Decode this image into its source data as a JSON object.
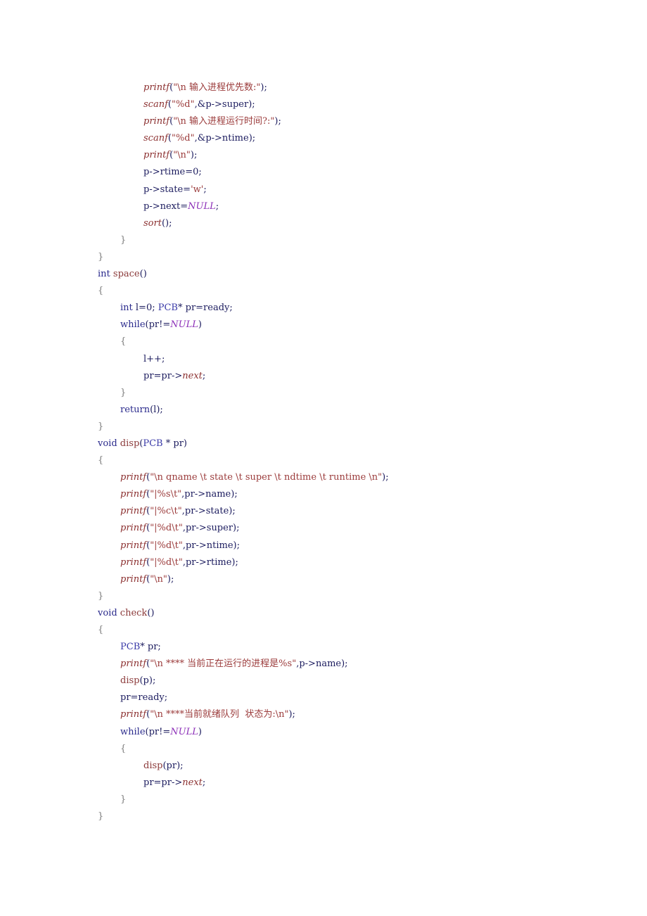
{
  "document": {
    "lines": [
      {
        "indent": 2,
        "tokens": [
          {
            "t": "printf",
            "c": "fni"
          },
          {
            "t": "(",
            "c": "id"
          },
          {
            "t": "\"\\n 输入进程优先数:\"",
            "c": "str"
          },
          {
            "t": ");",
            "c": "id"
          }
        ]
      },
      {
        "indent": 2,
        "tokens": [
          {
            "t": "scanf",
            "c": "fni"
          },
          {
            "t": "(",
            "c": "id"
          },
          {
            "t": "\"%d\"",
            "c": "str"
          },
          {
            "t": ",&p->super);",
            "c": "id"
          }
        ]
      },
      {
        "indent": 2,
        "tokens": [
          {
            "t": "printf",
            "c": "fni"
          },
          {
            "t": "(",
            "c": "id"
          },
          {
            "t": "\"\\n 输入进程运行时间?:\"",
            "c": "str"
          },
          {
            "t": ");",
            "c": "id"
          }
        ]
      },
      {
        "indent": 2,
        "tokens": [
          {
            "t": "scanf",
            "c": "fni"
          },
          {
            "t": "(",
            "c": "id"
          },
          {
            "t": "\"%d\"",
            "c": "str"
          },
          {
            "t": ",&p->ntime);",
            "c": "id"
          }
        ]
      },
      {
        "indent": 2,
        "tokens": [
          {
            "t": "printf",
            "c": "fni"
          },
          {
            "t": "(",
            "c": "id"
          },
          {
            "t": "\"\\n\"",
            "c": "str"
          },
          {
            "t": ");",
            "c": "id"
          }
        ]
      },
      {
        "indent": 2,
        "tokens": [
          {
            "t": "p->rtime=0;",
            "c": "id"
          }
        ]
      },
      {
        "indent": 2,
        "tokens": [
          {
            "t": "p->state=",
            "c": "id"
          },
          {
            "t": "'w'",
            "c": "str"
          },
          {
            "t": ";",
            "c": "id"
          }
        ]
      },
      {
        "indent": 2,
        "tokens": [
          {
            "t": "p->next=",
            "c": "id"
          },
          {
            "t": "NULL",
            "c": "nul"
          },
          {
            "t": ";",
            "c": "id"
          }
        ]
      },
      {
        "indent": 2,
        "tokens": [
          {
            "t": "sort",
            "c": "fni"
          },
          {
            "t": "();",
            "c": "id"
          }
        ]
      },
      {
        "indent": 1,
        "tokens": [
          {
            "t": "}",
            "c": "brace"
          }
        ]
      },
      {
        "indent": 0,
        "tokens": [
          {
            "t": "}",
            "c": "brace"
          }
        ]
      },
      {
        "indent": 0,
        "tokens": [
          {
            "t": "int",
            "c": "kw"
          },
          {
            "t": " ",
            "c": "id"
          },
          {
            "t": "space",
            "c": "fn"
          },
          {
            "t": "()",
            "c": "id"
          }
        ]
      },
      {
        "indent": 0,
        "tokens": [
          {
            "t": "{",
            "c": "brace"
          }
        ]
      },
      {
        "indent": 1,
        "tokens": [
          {
            "t": "int",
            "c": "kw"
          },
          {
            "t": " l=0; ",
            "c": "id"
          },
          {
            "t": "PCB",
            "c": "typ"
          },
          {
            "t": "* pr=ready;",
            "c": "id"
          }
        ]
      },
      {
        "indent": 1,
        "tokens": [
          {
            "t": "while",
            "c": "kw"
          },
          {
            "t": "(pr!=",
            "c": "id"
          },
          {
            "t": "NULL",
            "c": "nul"
          },
          {
            "t": ")",
            "c": "id"
          }
        ]
      },
      {
        "indent": 1,
        "tokens": [
          {
            "t": "{",
            "c": "brace"
          }
        ]
      },
      {
        "indent": 2,
        "tokens": [
          {
            "t": "l++;",
            "c": "id"
          }
        ]
      },
      {
        "indent": 2,
        "tokens": [
          {
            "t": "pr=pr->",
            "c": "id"
          },
          {
            "t": "next",
            "c": "fni"
          },
          {
            "t": ";",
            "c": "id"
          }
        ]
      },
      {
        "indent": 1,
        "tokens": [
          {
            "t": "}",
            "c": "brace"
          }
        ]
      },
      {
        "indent": 1,
        "tokens": [
          {
            "t": "return",
            "c": "kw"
          },
          {
            "t": "(l);",
            "c": "id"
          }
        ]
      },
      {
        "indent": 0,
        "tokens": [
          {
            "t": "}",
            "c": "brace"
          }
        ]
      },
      {
        "indent": 0,
        "tokens": [
          {
            "t": "void",
            "c": "kw"
          },
          {
            "t": " ",
            "c": "id"
          },
          {
            "t": "disp",
            "c": "fn"
          },
          {
            "t": "(",
            "c": "id"
          },
          {
            "t": "PCB",
            "c": "typ"
          },
          {
            "t": " * pr)",
            "c": "id"
          }
        ]
      },
      {
        "indent": 0,
        "tokens": [
          {
            "t": "{",
            "c": "brace"
          }
        ]
      },
      {
        "indent": 1,
        "tokens": [
          {
            "t": "printf",
            "c": "fni"
          },
          {
            "t": "(",
            "c": "id"
          },
          {
            "t": "\"\\n qname \\t state \\t super \\t ndtime \\t runtime \\n\"",
            "c": "str"
          },
          {
            "t": ");",
            "c": "id"
          }
        ]
      },
      {
        "indent": 1,
        "tokens": [
          {
            "t": "printf",
            "c": "fni"
          },
          {
            "t": "(",
            "c": "id"
          },
          {
            "t": "\"|%s\\t\"",
            "c": "str"
          },
          {
            "t": ",pr->name);",
            "c": "id"
          }
        ]
      },
      {
        "indent": 1,
        "tokens": [
          {
            "t": "printf",
            "c": "fni"
          },
          {
            "t": "(",
            "c": "id"
          },
          {
            "t": "\"|%c\\t\"",
            "c": "str"
          },
          {
            "t": ",pr->state);",
            "c": "id"
          }
        ]
      },
      {
        "indent": 1,
        "tokens": [
          {
            "t": "printf",
            "c": "fni"
          },
          {
            "t": "(",
            "c": "id"
          },
          {
            "t": "\"|%d\\t\"",
            "c": "str"
          },
          {
            "t": ",pr->super);",
            "c": "id"
          }
        ]
      },
      {
        "indent": 1,
        "tokens": [
          {
            "t": "printf",
            "c": "fni"
          },
          {
            "t": "(",
            "c": "id"
          },
          {
            "t": "\"|%d\\t\"",
            "c": "str"
          },
          {
            "t": ",pr->ntime);",
            "c": "id"
          }
        ]
      },
      {
        "indent": 1,
        "tokens": [
          {
            "t": "printf",
            "c": "fni"
          },
          {
            "t": "(",
            "c": "id"
          },
          {
            "t": "\"|%d\\t\"",
            "c": "str"
          },
          {
            "t": ",pr->rtime);",
            "c": "id"
          }
        ]
      },
      {
        "indent": 1,
        "tokens": [
          {
            "t": "printf",
            "c": "fni"
          },
          {
            "t": "(",
            "c": "id"
          },
          {
            "t": "\"\\n\"",
            "c": "str"
          },
          {
            "t": ");",
            "c": "id"
          }
        ]
      },
      {
        "indent": 0,
        "tokens": [
          {
            "t": "}",
            "c": "brace"
          }
        ]
      },
      {
        "indent": 0,
        "tokens": [
          {
            "t": "void",
            "c": "kw"
          },
          {
            "t": " ",
            "c": "id"
          },
          {
            "t": "check",
            "c": "fn"
          },
          {
            "t": "()",
            "c": "id"
          }
        ]
      },
      {
        "indent": 0,
        "tokens": [
          {
            "t": "{",
            "c": "brace"
          }
        ]
      },
      {
        "indent": 1,
        "tokens": [
          {
            "t": "PCB",
            "c": "typ"
          },
          {
            "t": "* pr;",
            "c": "id"
          }
        ]
      },
      {
        "indent": 1,
        "tokens": [
          {
            "t": "printf",
            "c": "fni"
          },
          {
            "t": "(",
            "c": "id"
          },
          {
            "t": "\"\\n **** 当前正在运行的进程是%s\"",
            "c": "str"
          },
          {
            "t": ",p->name);",
            "c": "id"
          }
        ]
      },
      {
        "indent": 1,
        "tokens": [
          {
            "t": "disp",
            "c": "fn"
          },
          {
            "t": "(p);",
            "c": "id"
          }
        ]
      },
      {
        "indent": 1,
        "tokens": [
          {
            "t": "pr=ready;",
            "c": "id"
          }
        ]
      },
      {
        "indent": 1,
        "tokens": [
          {
            "t": "printf",
            "c": "fni"
          },
          {
            "t": "(",
            "c": "id"
          },
          {
            "t": "\"\\n ****当前就绪队列  状态为:\\n\"",
            "c": "str"
          },
          {
            "t": ");",
            "c": "id"
          }
        ]
      },
      {
        "indent": 1,
        "tokens": [
          {
            "t": "while",
            "c": "kw"
          },
          {
            "t": "(pr!=",
            "c": "id"
          },
          {
            "t": "NULL",
            "c": "nul"
          },
          {
            "t": ")",
            "c": "id"
          }
        ]
      },
      {
        "indent": 1,
        "tokens": [
          {
            "t": "{",
            "c": "brace"
          }
        ]
      },
      {
        "indent": 2,
        "tokens": [
          {
            "t": "disp",
            "c": "fn"
          },
          {
            "t": "(pr);",
            "c": "id"
          }
        ]
      },
      {
        "indent": 2,
        "tokens": [
          {
            "t": "pr=pr->",
            "c": "id"
          },
          {
            "t": "next",
            "c": "fni"
          },
          {
            "t": ";",
            "c": "id"
          }
        ]
      },
      {
        "indent": 1,
        "tokens": [
          {
            "t": "}",
            "c": "brace"
          }
        ]
      },
      {
        "indent": 0,
        "tokens": [
          {
            "t": "}",
            "c": "brace"
          }
        ]
      }
    ]
  }
}
